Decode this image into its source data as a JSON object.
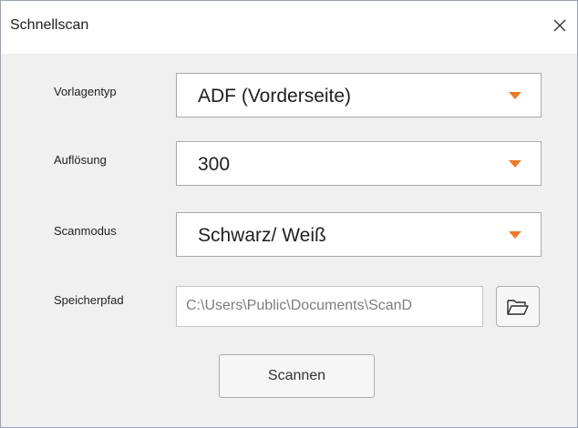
{
  "window": {
    "title": "Schnellscan",
    "close_icon": "close-icon"
  },
  "form": {
    "document_type": {
      "label": "Vorlagentyp",
      "selected": "ADF (Vorderseite)"
    },
    "resolution": {
      "label": "Auflösung",
      "selected": "300"
    },
    "scan_mode": {
      "label": "Scanmodus",
      "selected": "Schwarz/ Weiß"
    },
    "save_path": {
      "label": "Speicherpfad",
      "value": "C:\\Users\\Public\\Documents\\ScanD",
      "browse_icon": "folder-open-icon"
    }
  },
  "actions": {
    "scan_label": "Scannen"
  },
  "colors": {
    "dropdown_caret": "#ec7a2a",
    "window_background": "#f0f0f0",
    "titlebar_background": "#ffffff"
  }
}
